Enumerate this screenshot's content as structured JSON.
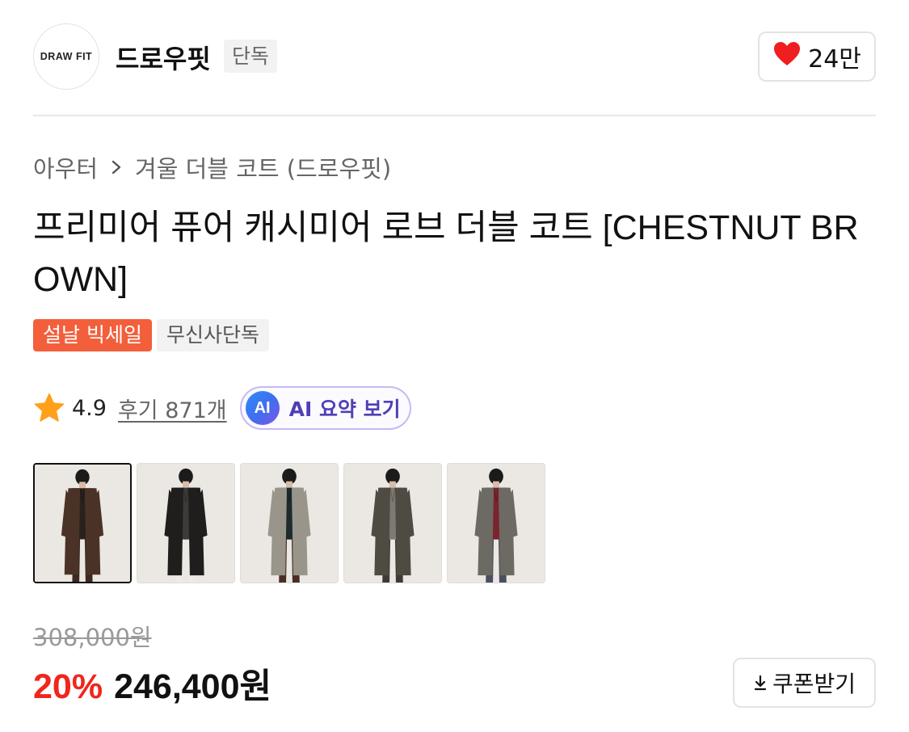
{
  "brand": {
    "logo_text": "DRAW FIT",
    "name": "드로우핏",
    "badge": "단독"
  },
  "like": {
    "icon": "heart-icon",
    "count": "24만",
    "color": "#f01e1e"
  },
  "breadcrumb": {
    "category": "아우터",
    "subcategory": "겨울 더블 코트 (드로우핏)"
  },
  "product": {
    "title": "프리미어 퓨어 캐시미어 로브 더블 코트 [CHESTNUT BROWN]"
  },
  "tags": [
    {
      "label": "설날 빅세일",
      "color": "#f35f3b"
    },
    {
      "label": "무신사단독"
    }
  ],
  "rating": {
    "icon": "star-icon",
    "value": "4.9",
    "reviews": "후기 871개"
  },
  "ai_summary": {
    "badge": "AI",
    "label": "AI 요약 보기"
  },
  "thumbnails": [
    {
      "coat": "#4a3326",
      "inner": "#2a211c",
      "pants": "#3a2a22",
      "selected": true
    },
    {
      "coat": "#1f1e1d",
      "inner": "#3b3b3a",
      "pants": "#ecebe6",
      "selected": false
    },
    {
      "coat": "#9a958b",
      "inner": "#1d2a2e",
      "pants": "#4b2c24",
      "selected": false
    },
    {
      "coat": "#4f4b43",
      "inner": "#7d7a73",
      "pants": "#3e3a34",
      "selected": false
    },
    {
      "coat": "#6d6a63",
      "inner": "#7a2430",
      "pants": "#4b4f5e",
      "selected": false
    }
  ],
  "price": {
    "original": "308,000원",
    "discount": "20%",
    "sale": "246,400원",
    "discount_color": "#f0261c"
  },
  "coupon": {
    "icon": "download-icon",
    "label": "쿠폰받기"
  }
}
